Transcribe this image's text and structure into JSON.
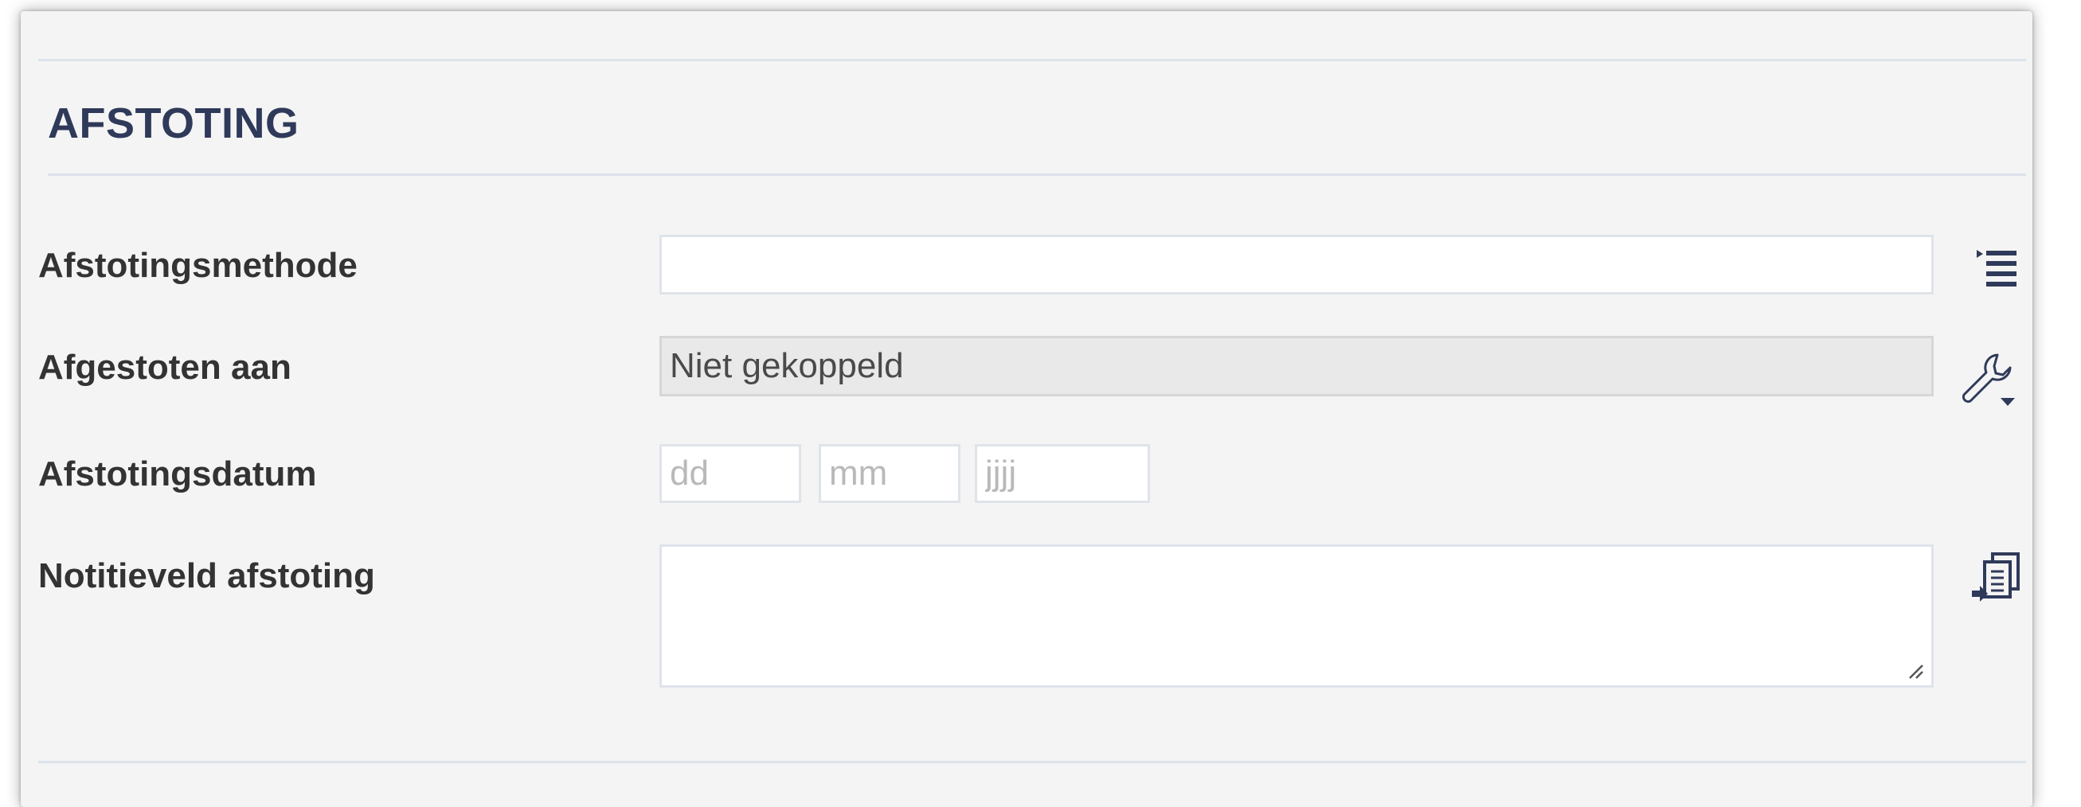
{
  "section": {
    "title": "AFSTOTING"
  },
  "fields": {
    "method": {
      "label": "Afstotingsmethode",
      "value": "",
      "icon": "list-picker-icon"
    },
    "disposed_to": {
      "label": "Afgestoten aan",
      "value": "Niet gekoppeld",
      "icon": "wrench-dropdown-icon"
    },
    "date": {
      "label": "Afstotingsdatum",
      "day_placeholder": "dd",
      "month_placeholder": "mm",
      "year_placeholder": "jjjj"
    },
    "note": {
      "label": "Notitieveld afstoting",
      "value": "",
      "icon": "insert-text-icon"
    }
  },
  "colors": {
    "panel_bg": "#f4f4f4",
    "title": "#2f3a5a",
    "icon": "#2f3a5a",
    "border": "#dfe3ea",
    "readonly_bg": "#e9e9e9"
  }
}
